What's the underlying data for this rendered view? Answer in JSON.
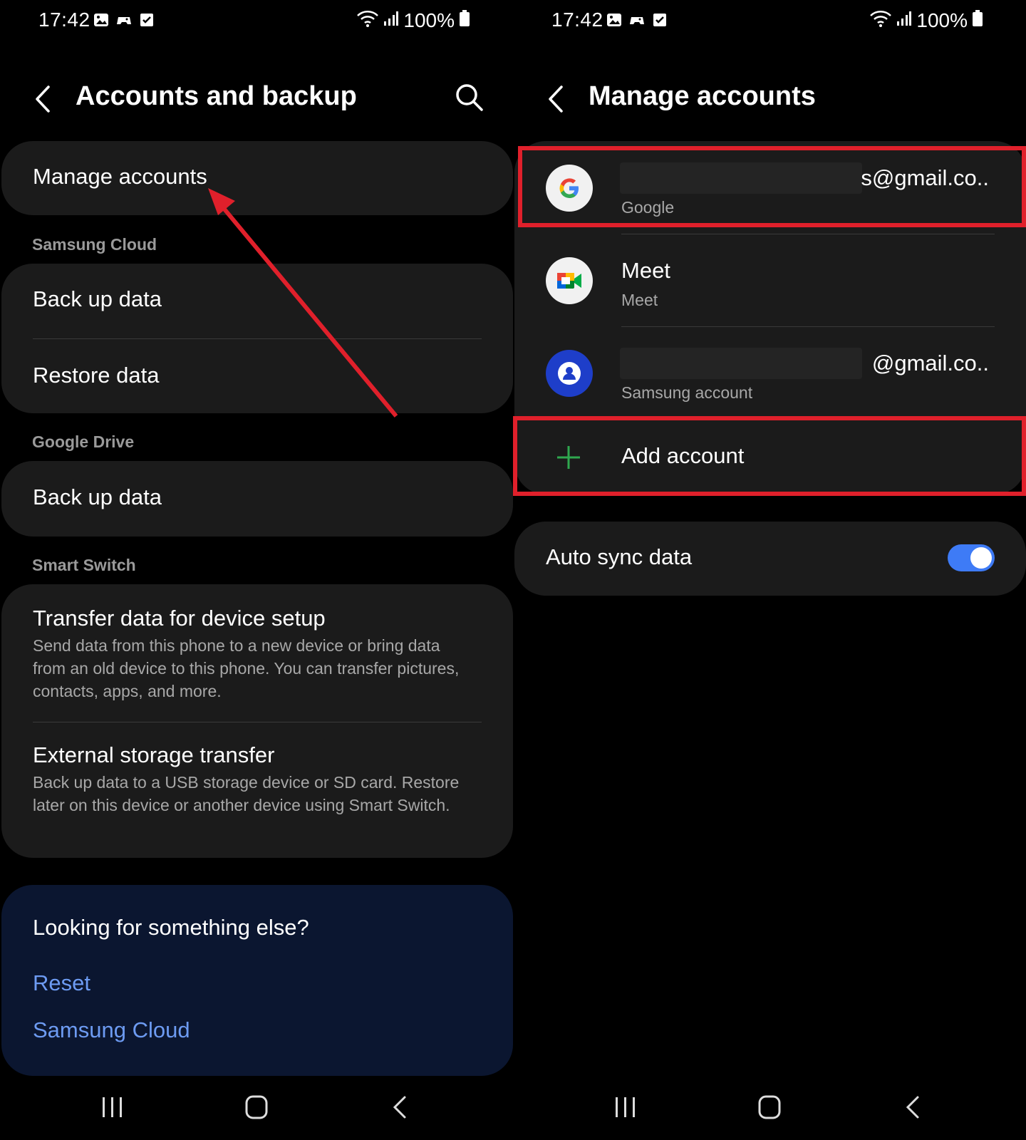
{
  "status_bar": {
    "time": "17:42",
    "battery": "100%"
  },
  "left": {
    "title": "Accounts and backup",
    "manage_accounts": "Manage accounts",
    "sections": {
      "samsung_cloud": "Samsung Cloud",
      "google_drive": "Google Drive",
      "smart_switch": "Smart Switch"
    },
    "samsung_cloud_items": [
      "Back up data",
      "Restore data"
    ],
    "google_drive_items": [
      "Back up data"
    ],
    "smart_switch_items": [
      {
        "title": "Transfer data for device setup",
        "subtitle": "Send data from this phone to a new device or bring data from an old device to this phone. You can transfer pictures, contacts, apps, and more."
      },
      {
        "title": "External storage transfer",
        "subtitle": "Back up data to a USB storage device or SD card. Restore later on this device or another device using Smart Switch."
      }
    ],
    "help": {
      "title": "Looking for something else?",
      "links": [
        "Reset",
        "Samsung Cloud"
      ]
    }
  },
  "right": {
    "title": "Manage accounts",
    "accounts": [
      {
        "email": "s@gmail.co..",
        "type": "Google",
        "icon": "google-icon"
      },
      {
        "title": "Meet",
        "type": "Meet",
        "icon": "meet-icon"
      },
      {
        "email": "@gmail.co..",
        "type": "Samsung account",
        "icon": "samsung-account-icon"
      }
    ],
    "add_account": "Add account",
    "auto_sync": {
      "label": "Auto sync data",
      "enabled": true
    }
  },
  "colors": {
    "highlight": "#e0202b",
    "link": "#6d9bf2",
    "toggle_on": "#3e7bf6",
    "card": "#1b1b1b",
    "help_card": "#0b1630"
  }
}
